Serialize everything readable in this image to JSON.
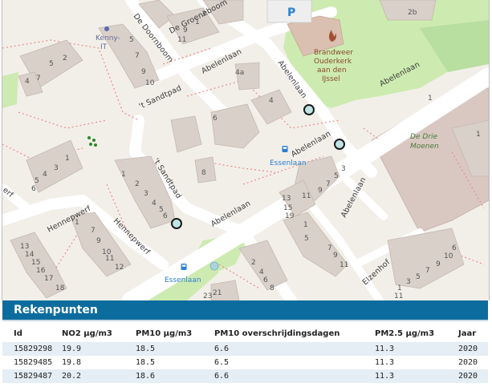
{
  "map": {
    "streets": {
      "abelenlaan": "Abelenlaan",
      "sandtpad": "'t Sandtpad",
      "doornboom": "De Doornboom",
      "groeneboom": "De Groeneboom",
      "hennepwerf": "Hennepwerf",
      "elzenhof": "Elzenhof",
      "werf_edge": "erf"
    },
    "pois": {
      "kenny_it": [
        "Kenny-",
        "IT"
      ],
      "brandweer": [
        "Brandweer",
        "Ouderkerk",
        "aan den",
        "IJssel"
      ],
      "drie_moenen": [
        "De Drie",
        "Moenen"
      ],
      "bus_stop_1": "Essenlaan",
      "bus_stop_2": "Essenlaan",
      "parking": "P"
    },
    "house_numbers": {
      "h2b": "2b",
      "h4a": "4a",
      "h4": "4",
      "h6": "6",
      "h8": "8",
      "h1": "1",
      "h3": "3",
      "h5": "5",
      "h7": "7",
      "h9": "9",
      "h10": "10",
      "h11": "11",
      "h12": "12",
      "h13": "13",
      "h14": "14",
      "h15": "15",
      "h16": "16",
      "h17": "17",
      "h18": "18",
      "h19": "19",
      "h21": "21",
      "h23": "23",
      "h2": "2",
      "h3b": "3",
      "h1b": "1"
    }
  },
  "panel": {
    "title": "Rekenpunten",
    "columns": {
      "id": "Id",
      "no2": "NO2 µg/m3",
      "pm10": "PM10 µg/m3",
      "pm10_days": "PM10 overschrijdingsdagen",
      "pm25": "PM2.5 µg/m3",
      "year": "Jaar"
    },
    "rows": [
      {
        "id": "15829298",
        "no2": "19.9",
        "pm10": "18.5",
        "pm10_days": "6.6",
        "pm25": "11.3",
        "year": "2020"
      },
      {
        "id": "15829485",
        "no2": "19.8",
        "pm10": "18.5",
        "pm10_days": "6.5",
        "pm25": "11.3",
        "year": "2020"
      },
      {
        "id": "15829487",
        "no2": "20.2",
        "pm10": "18.6",
        "pm10_days": "6.6",
        "pm25": "11.3",
        "year": "2020"
      }
    ]
  }
}
